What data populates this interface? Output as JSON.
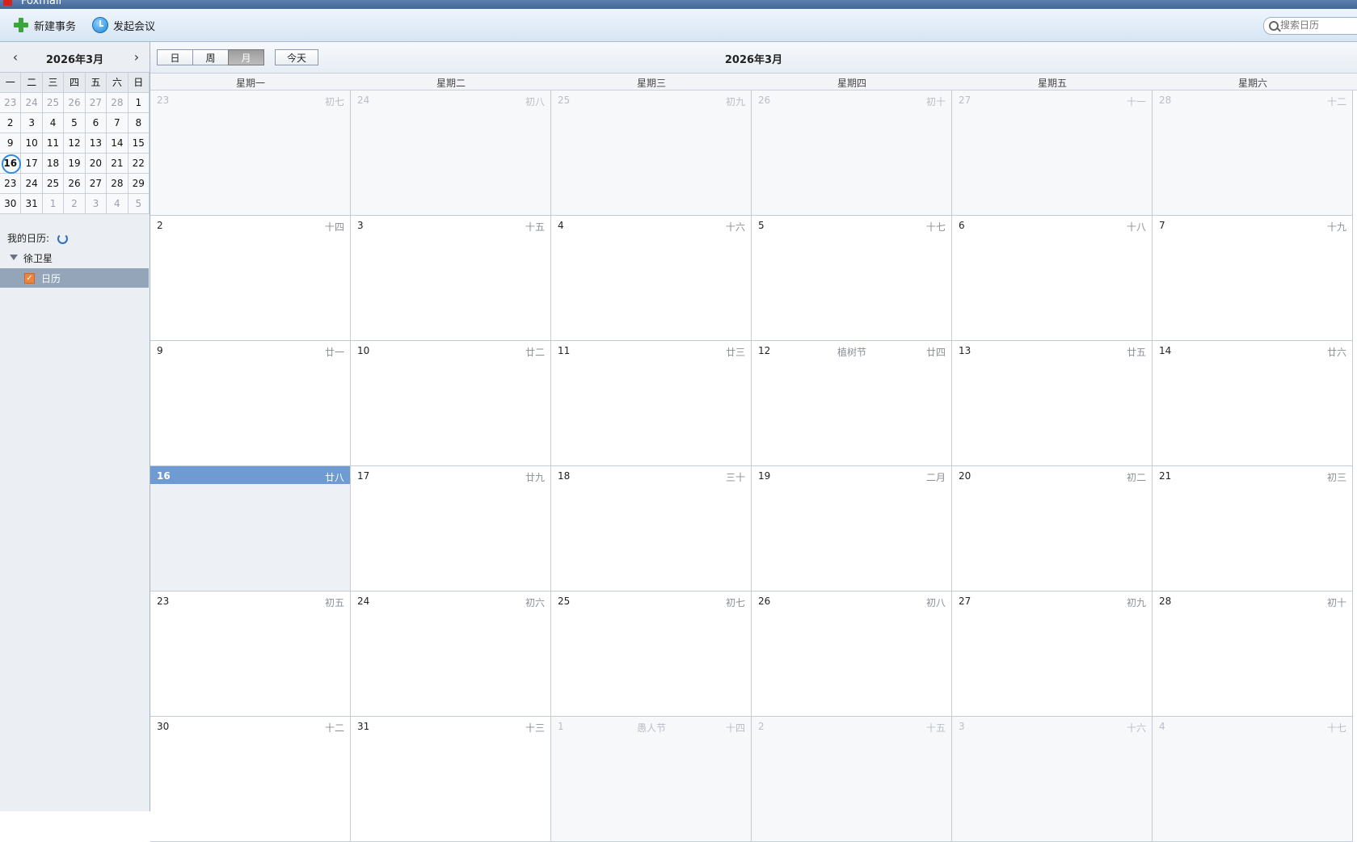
{
  "window": {
    "title": "Foxmail"
  },
  "toolbar": {
    "new_event_label": "新建事务",
    "meeting_label": "发起会议",
    "search_placeholder": "搜索日历"
  },
  "mini_calendar": {
    "title": "2026年3月",
    "prev_glyph": "‹",
    "next_glyph": "›",
    "weekday_headers": [
      "一",
      "二",
      "三",
      "四",
      "五",
      "六",
      "日"
    ],
    "weeks": [
      [
        {
          "d": "23",
          "other": true
        },
        {
          "d": "24",
          "other": true
        },
        {
          "d": "25",
          "other": true
        },
        {
          "d": "26",
          "other": true
        },
        {
          "d": "27",
          "other": true
        },
        {
          "d": "28",
          "other": true
        },
        {
          "d": "1"
        }
      ],
      [
        {
          "d": "2"
        },
        {
          "d": "3"
        },
        {
          "d": "4"
        },
        {
          "d": "5"
        },
        {
          "d": "6"
        },
        {
          "d": "7"
        },
        {
          "d": "8"
        }
      ],
      [
        {
          "d": "9"
        },
        {
          "d": "10"
        },
        {
          "d": "11"
        },
        {
          "d": "12"
        },
        {
          "d": "13"
        },
        {
          "d": "14"
        },
        {
          "d": "15"
        }
      ],
      [
        {
          "d": "16",
          "today": true
        },
        {
          "d": "17"
        },
        {
          "d": "18"
        },
        {
          "d": "19"
        },
        {
          "d": "20"
        },
        {
          "d": "21"
        },
        {
          "d": "22"
        }
      ],
      [
        {
          "d": "23"
        },
        {
          "d": "24"
        },
        {
          "d": "25"
        },
        {
          "d": "26"
        },
        {
          "d": "27"
        },
        {
          "d": "28"
        },
        {
          "d": "29"
        }
      ],
      [
        {
          "d": "30"
        },
        {
          "d": "31"
        },
        {
          "d": "1",
          "other": true
        },
        {
          "d": "2",
          "other": true
        },
        {
          "d": "3",
          "other": true
        },
        {
          "d": "4",
          "other": true
        },
        {
          "d": "5",
          "other": true
        }
      ]
    ]
  },
  "calendars": {
    "section_label": "我的日历:",
    "owner": "徐卫星",
    "items": [
      {
        "name": "日历",
        "checked": true,
        "color": "#f0843a"
      }
    ]
  },
  "view_switcher": {
    "day": "日",
    "week": "周",
    "month": "月",
    "today": "今天",
    "active": "month"
  },
  "month_view": {
    "title": "2026年3月",
    "weekdays": [
      "星期一",
      "星期二",
      "星期三",
      "星期四",
      "星期五",
      "星期六"
    ],
    "today_color": "#6e9bd2",
    "weeks": [
      [
        {
          "d": "23",
          "lunar": "初七",
          "other": true
        },
        {
          "d": "24",
          "lunar": "初八",
          "other": true
        },
        {
          "d": "25",
          "lunar": "初九",
          "other": true
        },
        {
          "d": "26",
          "lunar": "初十",
          "other": true
        },
        {
          "d": "27",
          "lunar": "十一",
          "other": true
        },
        {
          "d": "28",
          "lunar": "十二",
          "other": true
        }
      ],
      [
        {
          "d": "2",
          "lunar": "十四"
        },
        {
          "d": "3",
          "lunar": "十五"
        },
        {
          "d": "4",
          "lunar": "十六"
        },
        {
          "d": "5",
          "lunar": "十七"
        },
        {
          "d": "6",
          "lunar": "十八"
        },
        {
          "d": "7",
          "lunar": "十九"
        }
      ],
      [
        {
          "d": "9",
          "lunar": "廿一"
        },
        {
          "d": "10",
          "lunar": "廿二"
        },
        {
          "d": "11",
          "lunar": "廿三"
        },
        {
          "d": "12",
          "lunar": "廿四",
          "festival": "植树节"
        },
        {
          "d": "13",
          "lunar": "廿五"
        },
        {
          "d": "14",
          "lunar": "廿六"
        }
      ],
      [
        {
          "d": "16",
          "lunar": "廿八",
          "today": true
        },
        {
          "d": "17",
          "lunar": "廿九"
        },
        {
          "d": "18",
          "lunar": "三十"
        },
        {
          "d": "19",
          "lunar": "二月"
        },
        {
          "d": "20",
          "lunar": "初二"
        },
        {
          "d": "21",
          "lunar": "初三"
        }
      ],
      [
        {
          "d": "23",
          "lunar": "初五"
        },
        {
          "d": "24",
          "lunar": "初六"
        },
        {
          "d": "25",
          "lunar": "初七"
        },
        {
          "d": "26",
          "lunar": "初八"
        },
        {
          "d": "27",
          "lunar": "初九"
        },
        {
          "d": "28",
          "lunar": "初十"
        }
      ],
      [
        {
          "d": "30",
          "lunar": "十二"
        },
        {
          "d": "31",
          "lunar": "十三"
        },
        {
          "d": "1",
          "lunar": "十四",
          "festival": "愚人节",
          "other": true
        },
        {
          "d": "2",
          "lunar": "十五",
          "other": true
        },
        {
          "d": "3",
          "lunar": "十六",
          "other": true
        },
        {
          "d": "4",
          "lunar": "十七",
          "other": true
        }
      ]
    ]
  }
}
